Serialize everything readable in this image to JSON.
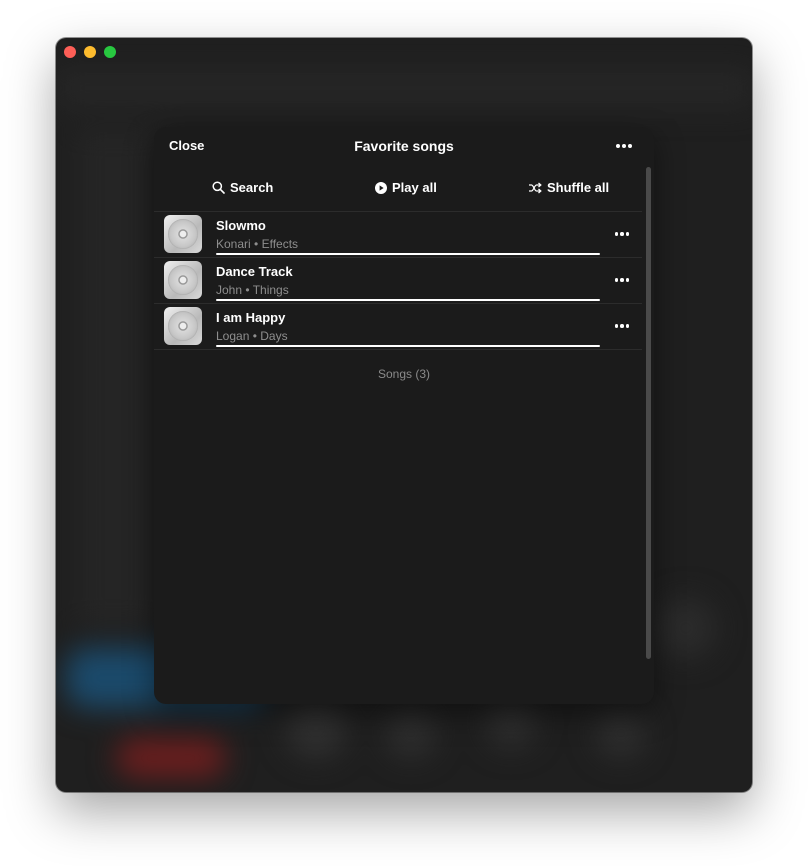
{
  "sheet": {
    "close_label": "Close",
    "title": "Favorite songs",
    "more_icon": "ellipsis-icon"
  },
  "actions": {
    "search_label": "Search",
    "play_all_label": "Play all",
    "shuffle_all_label": "Shuffle all"
  },
  "songs": [
    {
      "title": "Slowmo",
      "artist": "Konari",
      "album": "Effects",
      "separator": "•"
    },
    {
      "title": "Dance Track",
      "artist": "John",
      "album": "Things",
      "separator": "•"
    },
    {
      "title": "I am Happy",
      "artist": "Logan",
      "album": "Days",
      "separator": "•"
    }
  ],
  "footer": "Songs (3)",
  "colors": {
    "sheet_bg": "#1b1b1b",
    "text": "#ffffff",
    "secondary_text": "#8e8e8e",
    "traffic_close": "#fe5f57",
    "traffic_min": "#febc2e",
    "traffic_max": "#28c840"
  }
}
